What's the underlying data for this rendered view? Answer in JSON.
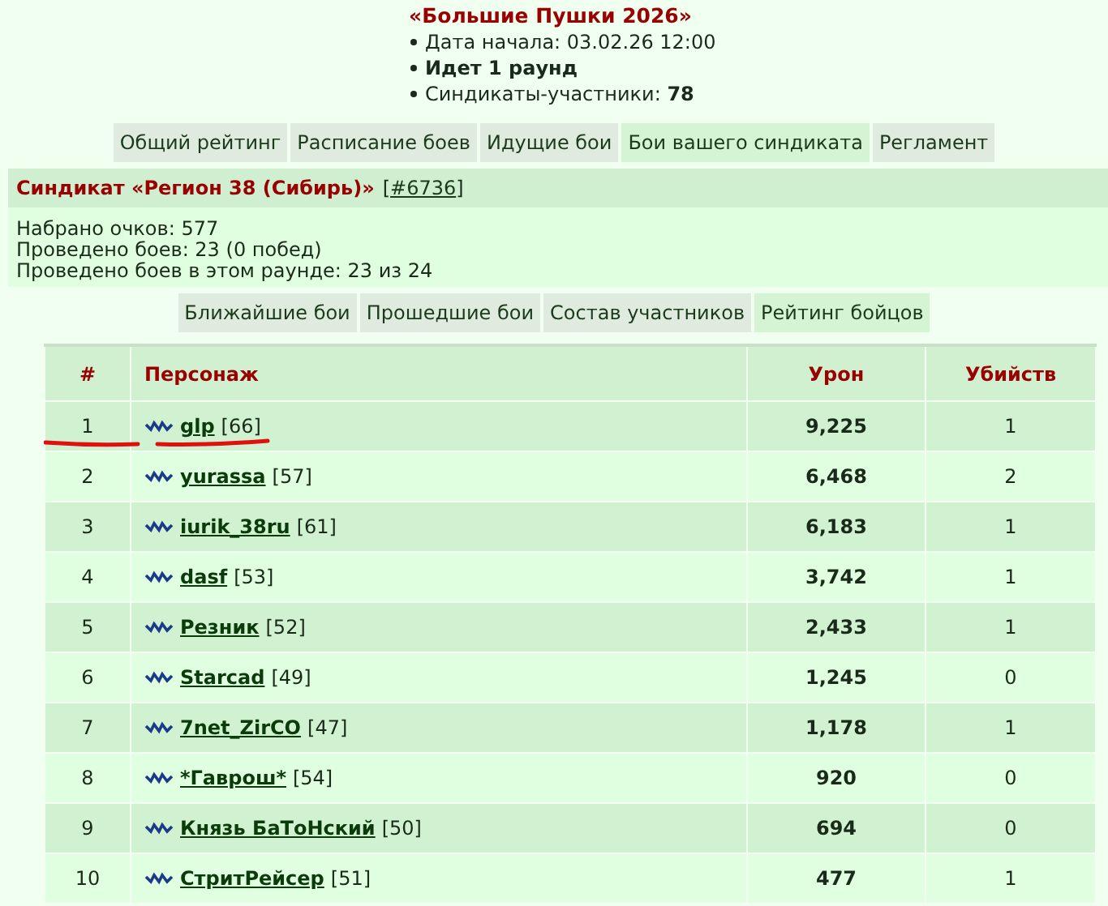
{
  "tournament": {
    "title": "«Большие Пушки 2026»",
    "facts": [
      {
        "label": "Дата начала: 03.02.26 12:00",
        "bold": false
      },
      {
        "label": "Идет 1 раунд",
        "bold": true
      },
      {
        "label": "Синдикаты-участники: ",
        "value": "78",
        "bold": false
      }
    ]
  },
  "tabs": [
    {
      "label": "Общий рейтинг",
      "selected": false
    },
    {
      "label": "Расписание боев",
      "selected": false
    },
    {
      "label": "Идущие бои",
      "selected": false
    },
    {
      "label": "Бои вашего синдиката",
      "selected": true
    },
    {
      "label": "Регламент",
      "selected": false
    }
  ],
  "syndicate": {
    "title": "Синдикат «Регион 38 (Сибирь)»",
    "id_open": "[",
    "id_link": "#6736",
    "id_close": "]",
    "stats": [
      "Набрано очков: 577",
      "Проведено боев: 23 (0 побед)",
      "Проведено боев в этом раунде: 23 из 24"
    ]
  },
  "subtabs": [
    {
      "label": "Ближайшие бои",
      "selected": false
    },
    {
      "label": "Прошедшие бои",
      "selected": false
    },
    {
      "label": "Состав участников",
      "selected": false
    },
    {
      "label": "Рейтинг бойцов",
      "selected": true
    }
  ],
  "table": {
    "columns": [
      "#",
      "Персонаж",
      "Урон",
      "Убийств"
    ],
    "rows": [
      {
        "rank": "1",
        "name": "glp",
        "level": "[66]",
        "damage": "9,225",
        "kills": "1",
        "marked": true
      },
      {
        "rank": "2",
        "name": "yurassa",
        "level": "[57]",
        "damage": "6,468",
        "kills": "2",
        "marked": false
      },
      {
        "rank": "3",
        "name": "iurik_38ru",
        "level": "[61]",
        "damage": "6,183",
        "kills": "1",
        "marked": false
      },
      {
        "rank": "4",
        "name": "dasf",
        "level": "[53]",
        "damage": "3,742",
        "kills": "1",
        "marked": false
      },
      {
        "rank": "5",
        "name": "Резник",
        "level": "[52]",
        "damage": "2,433",
        "kills": "1",
        "marked": false
      },
      {
        "rank": "6",
        "name": "Starcad",
        "level": "[49]",
        "damage": "1,245",
        "kills": "0",
        "marked": false
      },
      {
        "rank": "7",
        "name": "7net_ZirCO",
        "level": "[47]",
        "damage": "1,178",
        "kills": "1",
        "marked": false
      },
      {
        "rank": "8",
        "name": "*Гаврош*",
        "level": "[54]",
        "damage": "920",
        "kills": "0",
        "marked": false
      },
      {
        "rank": "9",
        "name": "Князь БаТоНский",
        "level": "[50]",
        "damage": "694",
        "kills": "0",
        "marked": false
      },
      {
        "rank": "10",
        "name": "СтритРейсер",
        "level": "[51]",
        "damage": "477",
        "kills": "1",
        "marked": false
      }
    ]
  }
}
